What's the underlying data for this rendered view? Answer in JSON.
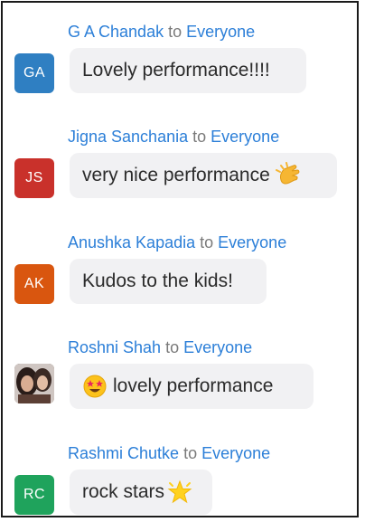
{
  "messages": [
    {
      "sender": "G A Chandak",
      "to": "to",
      "recipient": "Everyone",
      "initials": "GA",
      "avatar_color": "#2f7fc2",
      "text": "Lovely performance!!!!",
      "emoji_after": "",
      "emoji_before": ""
    },
    {
      "sender": "Jigna  Sanchania",
      "to": "to",
      "recipient": "Everyone",
      "initials": "JS",
      "avatar_color": "#c9312b",
      "text": "very nice performance",
      "emoji_after": "clapping-hands-icon",
      "emoji_before": ""
    },
    {
      "sender": "Anushka Kapadia",
      "to": "to",
      "recipient": "Everyone",
      "initials": "AK",
      "avatar_color": "#d9560f",
      "text": "Kudos to the kids!",
      "emoji_after": "",
      "emoji_before": ""
    },
    {
      "sender": "Roshni Shah",
      "to": "to",
      "recipient": "Everyone",
      "initials": "",
      "avatar_color": "",
      "text": "lovely performance",
      "emoji_after": "",
      "emoji_before": "star-struck-face-icon"
    },
    {
      "sender": "Rashmi Chutke",
      "to": "to",
      "recipient": "Everyone",
      "initials": "RC",
      "avatar_color": "#1fa35c",
      "text": "rock stars",
      "emoji_after": "star-icon",
      "emoji_before": ""
    }
  ],
  "colors": {
    "link": "#2c7fd8",
    "muted": "#7a7a7a",
    "bubble": "#f1f1f3"
  }
}
